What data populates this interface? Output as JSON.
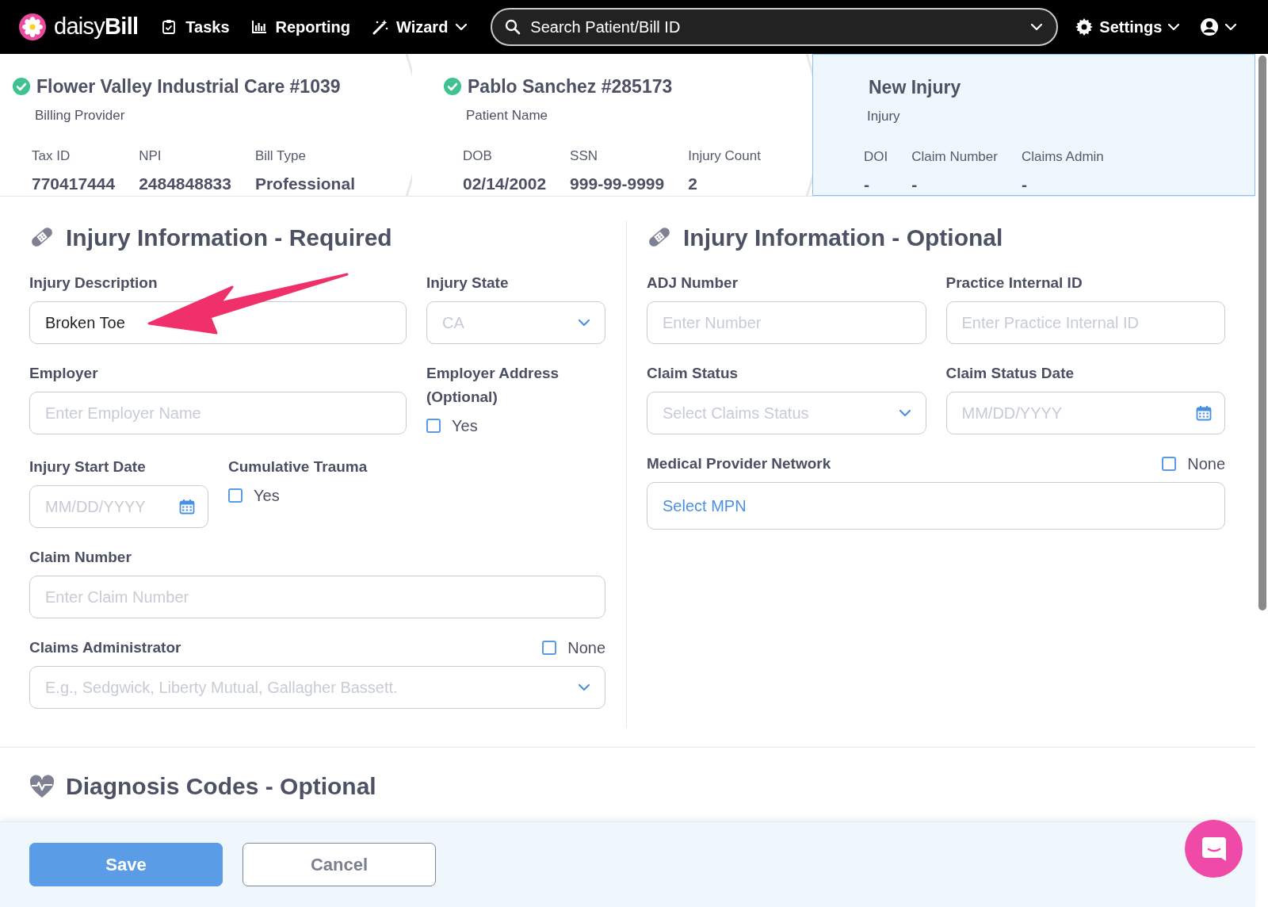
{
  "nav": {
    "logo": "daisy**Bill**",
    "items": [
      {
        "label": "Tasks",
        "kind": "tasks",
        "dropdown": false
      },
      {
        "label": "Reporting",
        "kind": "reporting",
        "dropdown": false
      },
      {
        "label": "Wizard",
        "kind": "wizard",
        "dropdown": true
      }
    ],
    "search": {
      "placeholder": "Search Patient/Bill ID"
    },
    "settings": {
      "label": "Settings"
    }
  },
  "steps": [
    {
      "title": "Flower Valley Industrial Care #1039",
      "subtitle": "Billing Provider",
      "complete": true,
      "selected": false,
      "fields": [
        {
          "label": "Tax ID",
          "value": "770417444"
        },
        {
          "label": "NPI",
          "value": "2484848833"
        },
        {
          "label": "Bill Type",
          "value": "Professional"
        }
      ]
    },
    {
      "title": "Pablo Sanchez #285173",
      "subtitle": "Patient Name",
      "complete": true,
      "selected": false,
      "fields": [
        {
          "label": "DOB",
          "value": "02/14/2002"
        },
        {
          "label": "SSN",
          "value": "999-99-9999"
        },
        {
          "label": "Injury Count",
          "value": "2"
        }
      ]
    },
    {
      "title": "New Injury",
      "subtitle": "Injury",
      "complete": false,
      "selected": true,
      "fields": [
        {
          "label": "DOI",
          "value": "-"
        },
        {
          "label": "Claim Number",
          "value": "-"
        },
        {
          "label": "Claims Admin",
          "value": "-"
        }
      ]
    }
  ],
  "sections": [
    {
      "title": "Injury Information - Required",
      "rows": [
        [
          {
            "kind": "text",
            "label": "Injury Description",
            "value": "Broken Toe"
          },
          {
            "kind": "select",
            "label": "Injury State",
            "placeholder": "CA"
          }
        ],
        [
          {
            "kind": "text",
            "label": "Employer",
            "placeholder": "Enter Employer Name"
          },
          {
            "kind": "checkbox",
            "label": "Employer Address (Optional)",
            "option": "Yes",
            "checked": false
          }
        ],
        [
          {
            "kind": "date",
            "label": "Injury Start Date",
            "placeholder": "MM/DD/YYYY"
          },
          {
            "kind": "checkbox",
            "label": "Cumulative Trauma",
            "option": "Yes",
            "checked": false
          }
        ],
        [
          {
            "kind": "text",
            "label": "Claim Number",
            "placeholder": "Enter Claim Number"
          }
        ],
        [
          {
            "kind": "select",
            "label": "Claims Administrator",
            "placeholder": "E.g., Sedgwick, Liberty Mutual, Gallagher Bassett.",
            "none": {
              "label": "None",
              "checked": false
            }
          }
        ]
      ]
    },
    {
      "title": "Injury Information - Optional",
      "rows": [
        [
          {
            "kind": "text",
            "label": "ADJ Number",
            "placeholder": "Enter Number"
          },
          {
            "kind": "text",
            "label": "Practice Internal ID",
            "placeholder": "Enter Practice Internal ID"
          }
        ],
        [
          {
            "kind": "select",
            "label": "Claim Status",
            "placeholder": "Select Claims Status"
          },
          {
            "kind": "date",
            "label": "Claim Status Date",
            "placeholder": "MM/DD/YYYY"
          }
        ],
        [
          {
            "kind": "link",
            "label": "Medical Provider Network",
            "value": "Select MPN",
            "none": {
              "label": "None",
              "checked": false
            }
          }
        ]
      ]
    }
  ],
  "diagnosis": {
    "title": "Diagnosis Codes - Optional"
  },
  "footer": {
    "buttons": [
      {
        "label": "Save",
        "kind": "primary"
      },
      {
        "label": "Cancel",
        "kind": "secondary"
      }
    ]
  }
}
